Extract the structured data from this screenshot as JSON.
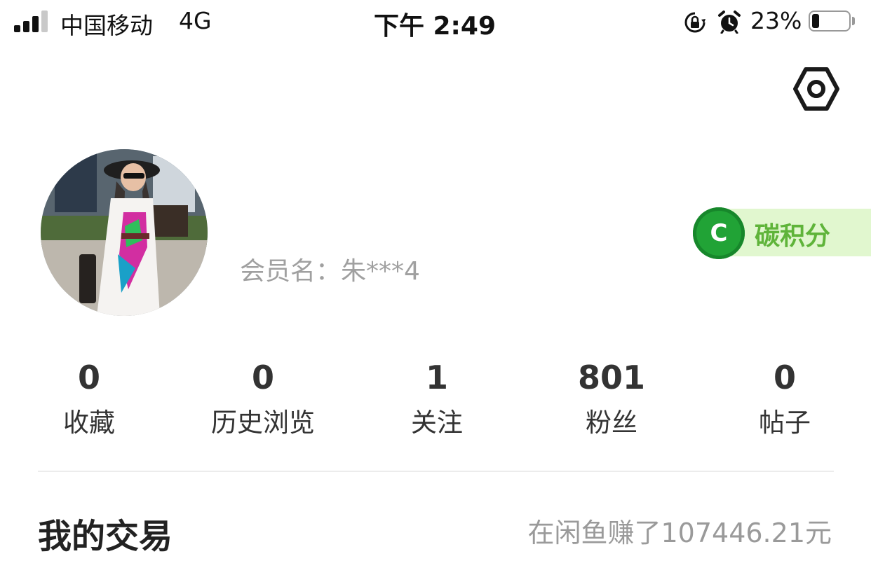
{
  "status_bar": {
    "carrier": "中国移动",
    "network": "4G",
    "time": "下午 2:49",
    "battery_percent": "23%",
    "icons": [
      "signal-icon",
      "rotation-lock-icon",
      "alarm-icon",
      "battery-icon"
    ]
  },
  "header": {
    "settings_icon": "gear-icon"
  },
  "profile": {
    "username_prefix": "会员名：",
    "username": "朱***4",
    "carbon_points": {
      "badge_letter": "C",
      "label": "碳积分",
      "color": "#21a336"
    }
  },
  "stats": [
    {
      "value": "0",
      "label": "收藏"
    },
    {
      "value": "0",
      "label": "历史浏览"
    },
    {
      "value": "1",
      "label": "关注"
    },
    {
      "value": "801",
      "label": "粉丝"
    },
    {
      "value": "0",
      "label": "帖子"
    }
  ],
  "trade_section": {
    "title": "我的交易",
    "earnings": "在闲鱼赚了107446.21元"
  }
}
